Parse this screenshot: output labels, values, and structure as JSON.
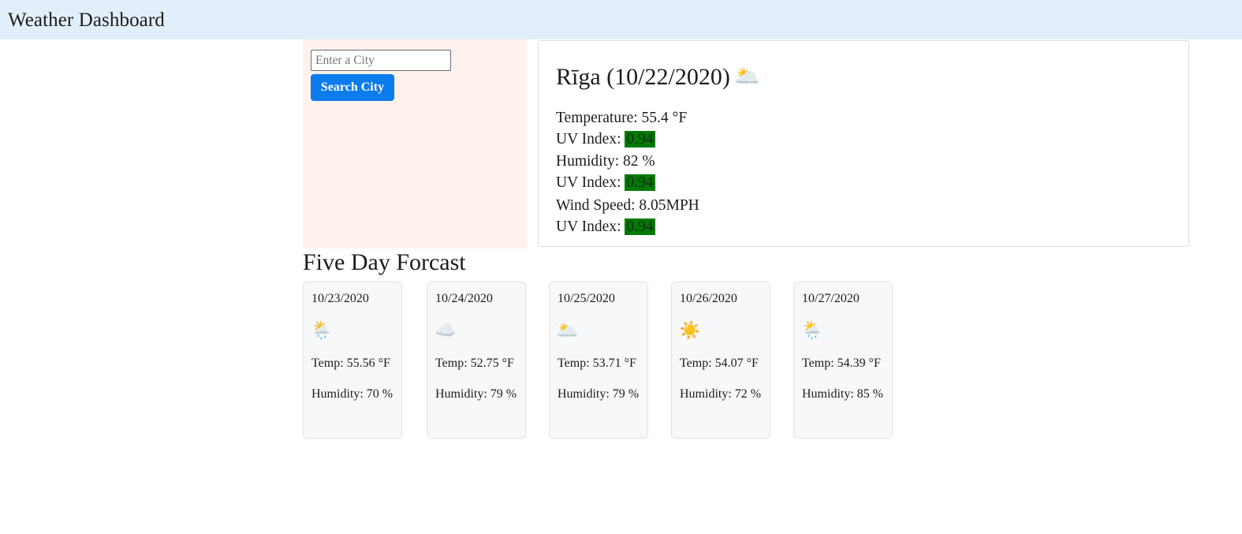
{
  "header": {
    "title": "Weather Dashboard",
    "background_color": "#e2effa"
  },
  "search": {
    "panel_background_color": "#fdf2ee",
    "input_value": "",
    "placeholder": "Enter a City",
    "button_label": "Search City",
    "button_color": "#0c7cec"
  },
  "current": {
    "title": "Rīga (10/22/2020)",
    "icon": "broken-clouds-emoji",
    "icon_glyph": "🌥️",
    "uv_highlight_color": "#007a00",
    "stats": [
      {
        "label": "Temperature: 55.4 °F",
        "uv_label": "UV Index: ",
        "uv_value": "0.94"
      },
      {
        "label": "Humidity: 82 %",
        "uv_label": "UV Index: ",
        "uv_value": "0.94"
      },
      {
        "label": "Wind Speed: 8.05MPH",
        "uv_label": "UV Index: ",
        "uv_value": "0.94"
      }
    ]
  },
  "forecast": {
    "heading": "Five Day Forcast",
    "cards": [
      {
        "date": "10/23/2020",
        "icon": "rain-with-sun-emoji",
        "icon_glyph": "🌦️",
        "temp": "Temp: 55.56 °F",
        "humidity": "Humidity: 70 %"
      },
      {
        "date": "10/24/2020",
        "icon": "cloud-emoji",
        "icon_glyph": "☁️",
        "temp": "Temp: 52.75 °F",
        "humidity": "Humidity: 79 %"
      },
      {
        "date": "10/25/2020",
        "icon": "broken-clouds-emoji",
        "icon_glyph": "🌥️",
        "temp": "Temp: 53.71 °F",
        "humidity": "Humidity: 79 %"
      },
      {
        "date": "10/26/2020",
        "icon": "sun-emoji",
        "icon_glyph": "☀️",
        "temp": "Temp: 54.07 °F",
        "humidity": "Humidity: 72 %"
      },
      {
        "date": "10/27/2020",
        "icon": "rain-with-sun-emoji",
        "icon_glyph": "🌦️",
        "temp": "Temp: 54.39 °F",
        "humidity": "Humidity: 85 %"
      }
    ]
  }
}
